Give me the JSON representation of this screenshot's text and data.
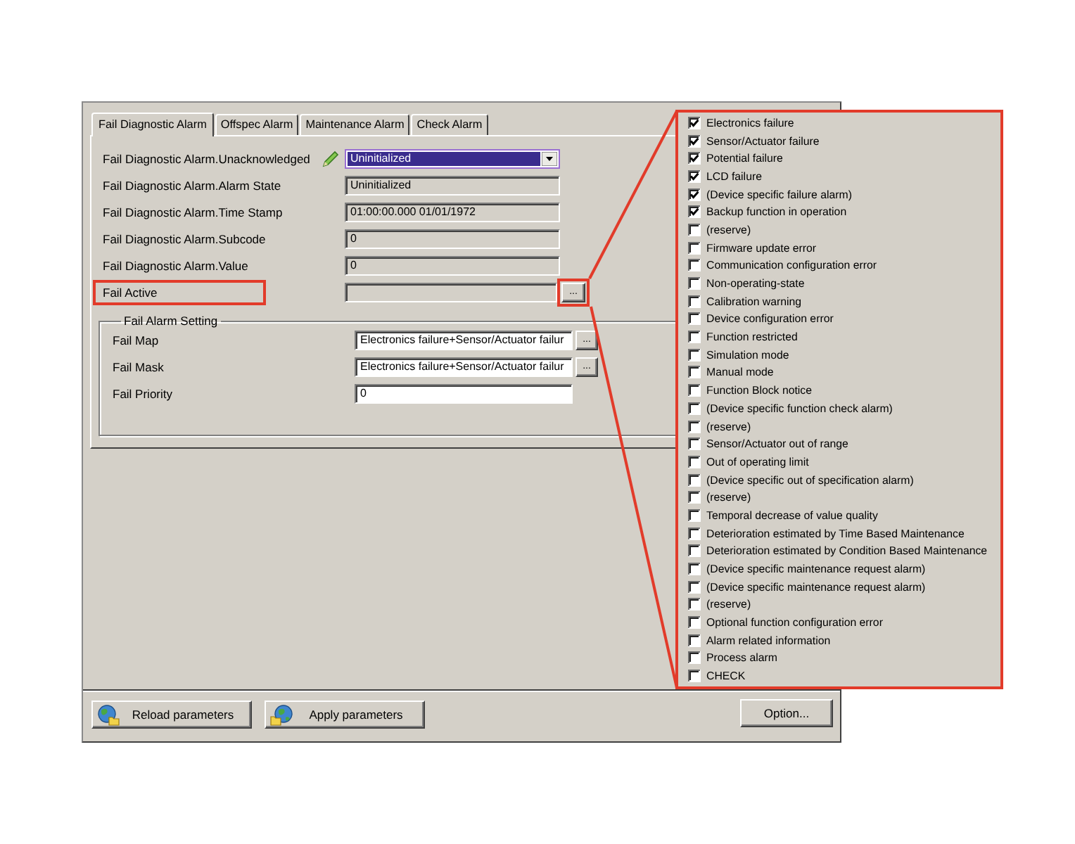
{
  "tabs": [
    {
      "label": "Fail Diagnostic Alarm",
      "selected": true
    },
    {
      "label": "Offspec Alarm",
      "selected": false
    },
    {
      "label": "Maintenance Alarm",
      "selected": false
    },
    {
      "label": "Check Alarm",
      "selected": false
    }
  ],
  "fields": [
    {
      "label": "Fail Diagnostic Alarm.Unacknowledged",
      "kind": "dropdown",
      "value": "Uninitialized",
      "edited": true,
      "readonly": false,
      "callout": false
    },
    {
      "label": "Fail Diagnostic Alarm.Alarm State",
      "kind": "text",
      "value": "Uninitialized",
      "edited": false,
      "readonly": true,
      "callout": false
    },
    {
      "label": "Fail Diagnostic Alarm.Time Stamp",
      "kind": "text",
      "value": "01:00:00.000 01/01/1972",
      "edited": false,
      "readonly": true,
      "callout": false
    },
    {
      "label": "Fail Diagnostic Alarm.Subcode",
      "kind": "text",
      "value": "0",
      "edited": false,
      "readonly": true,
      "callout": false
    },
    {
      "label": "Fail Diagnostic Alarm.Value",
      "kind": "text",
      "value": "0",
      "edited": false,
      "readonly": true,
      "callout": false
    },
    {
      "label": "Fail Active",
      "kind": "browse",
      "button": "...",
      "edited": false,
      "readonly": true,
      "callout": true
    }
  ],
  "group": {
    "title": "Fail Alarm Setting",
    "fields": [
      {
        "label": "Fail Map",
        "kind": "browse",
        "value": "Electronics failure+Sensor/Actuator failur",
        "button": "...",
        "readonly": false
      },
      {
        "label": "Fail Mask",
        "kind": "browse",
        "value": "Electronics failure+Sensor/Actuator failur",
        "button": "...",
        "readonly": false
      },
      {
        "label": "Fail Priority",
        "kind": "text",
        "value": "0",
        "readonly": false
      }
    ]
  },
  "alarm_bits": [
    {
      "label": "Electronics failure",
      "checked": true
    },
    {
      "label": "Sensor/Actuator failure",
      "checked": true
    },
    {
      "label": "Potential failure",
      "checked": true
    },
    {
      "label": "LCD failure",
      "checked": true
    },
    {
      "label": "(Device specific failure alarm)",
      "checked": true
    },
    {
      "label": "Backup function in operation",
      "checked": true
    },
    {
      "label": "(reserve)",
      "checked": false
    },
    {
      "label": "Firmware update error",
      "checked": false
    },
    {
      "label": "Communication configuration error",
      "checked": false
    },
    {
      "label": "Non-operating-state",
      "checked": false
    },
    {
      "label": "Calibration warning",
      "checked": false
    },
    {
      "label": "Device configuration error",
      "checked": false
    },
    {
      "label": "Function restricted",
      "checked": false
    },
    {
      "label": "Simulation mode",
      "checked": false
    },
    {
      "label": "Manual mode",
      "checked": false
    },
    {
      "label": "Function Block notice",
      "checked": false
    },
    {
      "label": "(Device specific function check alarm)",
      "checked": false
    },
    {
      "label": "(reserve)",
      "checked": false
    },
    {
      "label": "Sensor/Actuator out of range",
      "checked": false
    },
    {
      "label": "Out of operating limit",
      "checked": false
    },
    {
      "label": "(Device specific out of specification alarm)",
      "checked": false
    },
    {
      "label": "(reserve)",
      "checked": false
    },
    {
      "label": "Temporal decrease of value quality",
      "checked": false
    },
    {
      "label": "Deterioration estimated by Time Based Maintenance",
      "checked": false
    },
    {
      "label": "Deterioration estimated by Condition Based Maintenance",
      "checked": false
    },
    {
      "label": "(Device specific maintenance request alarm)",
      "checked": false
    },
    {
      "label": "(Device specific maintenance request alarm)",
      "checked": false
    },
    {
      "label": "(reserve)",
      "checked": false
    },
    {
      "label": "Optional function configuration error",
      "checked": false
    },
    {
      "label": "Alarm related information",
      "checked": false
    },
    {
      "label": "Process alarm",
      "checked": false
    },
    {
      "label": "CHECK",
      "checked": false
    }
  ],
  "footer": {
    "left_buttons": [
      {
        "label": "Reload parameters",
        "kind": "reload"
      },
      {
        "label": "Apply parameters",
        "kind": "apply"
      }
    ],
    "right_buttons": [
      {
        "label": "Option...",
        "kind": "plain"
      }
    ]
  }
}
